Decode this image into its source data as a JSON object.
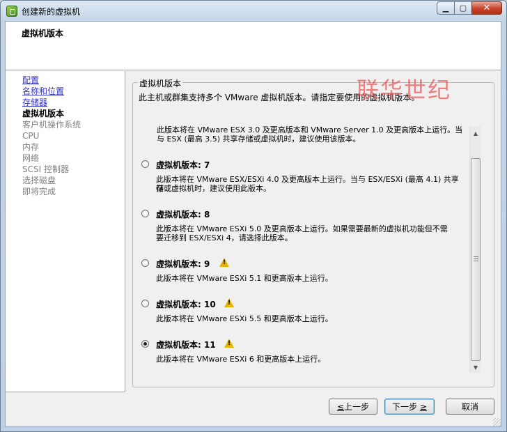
{
  "window": {
    "title": "创建新的虚拟机",
    "controls": {
      "minimize": "▁",
      "maximize": "▢",
      "close": "✕"
    }
  },
  "header": {
    "title": "虚拟机版本"
  },
  "sidebar": {
    "items": [
      {
        "label": "配置",
        "state": "done"
      },
      {
        "label": "名称和位置",
        "state": "done"
      },
      {
        "label": "存储器",
        "state": "done"
      },
      {
        "label": "虚拟机版本",
        "state": "current"
      },
      {
        "label": "客户机操作系统",
        "state": "future"
      },
      {
        "label": "CPU",
        "state": "future"
      },
      {
        "label": "内存",
        "state": "future"
      },
      {
        "label": "网络",
        "state": "future"
      },
      {
        "label": "SCSI 控制器",
        "state": "future"
      },
      {
        "label": "选择磁盘",
        "state": "future"
      },
      {
        "label": "即将完成",
        "state": "future"
      }
    ]
  },
  "main": {
    "group_title": "虚拟机版本",
    "description": "此主机或群集支持多个 VMware 虚拟机版本。请指定要使用的虚拟机版本。",
    "partial_option": {
      "line1": "此版本将在 VMware ESX 3.0 及更高版本和 VMware Server 1.0 及更高版本上运行。当",
      "line2": "与 ESX (最高 3.5) 共享存储或虚拟机时，建议使用该版本。"
    },
    "options": [
      {
        "label": "虚拟机版本: 7",
        "desc1": "此版本将在 VMware ESX/ESXi 4.0 及更高版本上运行。当与 ESX/ESXi (最高 4.1) 共享存",
        "desc2": "储或虚拟机时，建议使用此版本。",
        "warning": false,
        "selected": false
      },
      {
        "label": "虚拟机版本: 8",
        "desc1": "此版本将在 VMware ESXi 5.0 及更高版本上运行。如果需要最新的虚拟机功能但不需",
        "desc2": "要迁移到 ESX/ESXi 4，请选择此版本。",
        "warning": false,
        "selected": false
      },
      {
        "label": "虚拟机版本: 9",
        "desc1": "此版本将在 VMware ESXi 5.1 和更高版本上运行。",
        "desc2": "",
        "warning": true,
        "selected": false
      },
      {
        "label": "虚拟机版本: 10",
        "desc1": "此版本将在 VMware ESXi 5.5 和更高版本上运行。",
        "desc2": "",
        "warning": true,
        "selected": false
      },
      {
        "label": "虚拟机版本: 11",
        "desc1": "此版本将在 VMware ESXi 6 和更高版本上运行。",
        "desc2": "",
        "warning": true,
        "selected": true
      }
    ],
    "scroll_icons": {
      "up": "▲",
      "down": "▼"
    }
  },
  "buttons": {
    "back_underline": "≤",
    "back_text": "上一步",
    "next_text": "下一步",
    "next_underline": "≥",
    "cancel": "取消"
  },
  "watermark": "联华世纪",
  "colors": {
    "link": "#3333cc",
    "warning": "#e6b400",
    "close_button": "#c7432a"
  }
}
